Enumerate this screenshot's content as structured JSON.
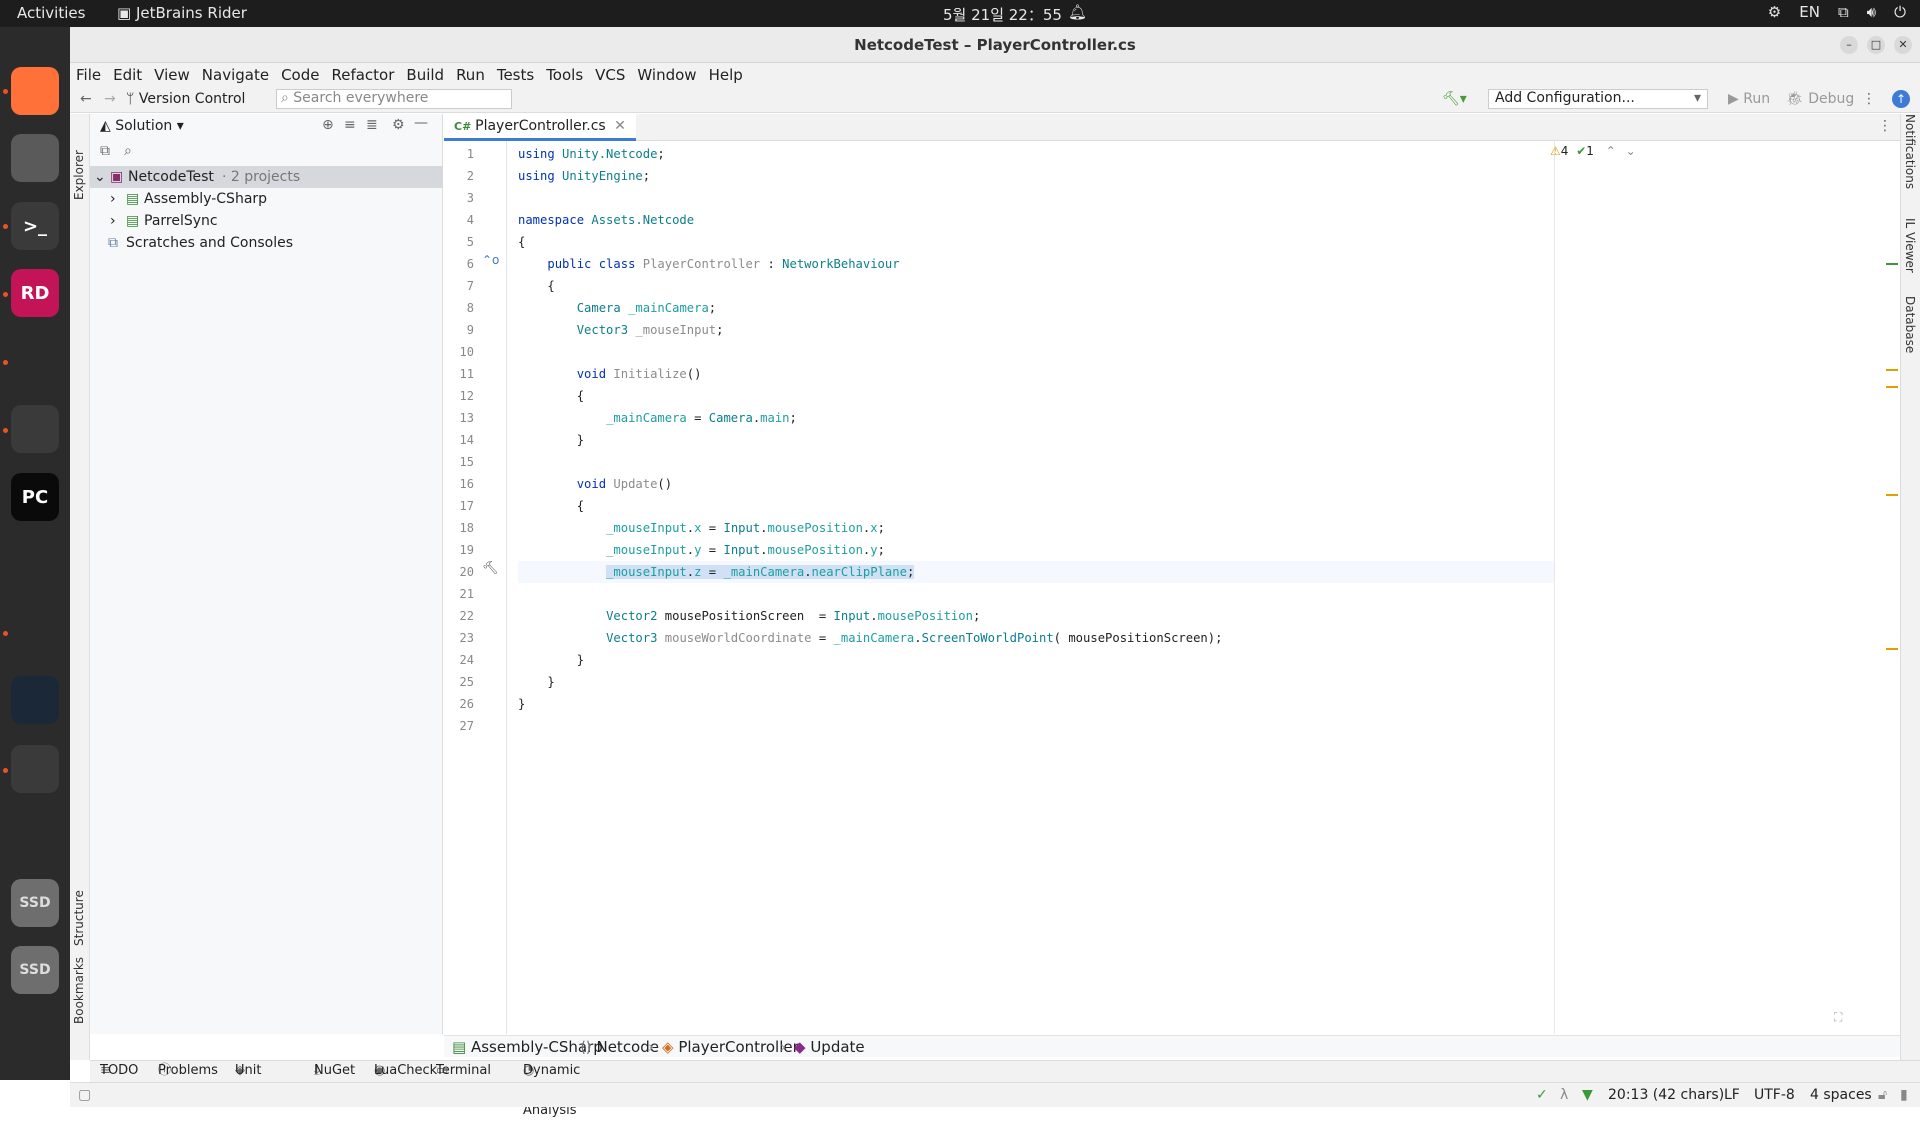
{
  "topbar": {
    "activities": "Activities",
    "app": "JetBrains Rider",
    "clock": "5월 21일  22：55",
    "lang": "EN"
  },
  "window": {
    "title": "NetcodeTest – PlayerController.cs"
  },
  "menu": [
    "File",
    "Edit",
    "View",
    "Navigate",
    "Code",
    "Refactor",
    "Build",
    "Run",
    "Tests",
    "Tools",
    "VCS",
    "Window",
    "Help"
  ],
  "toolbar": {
    "vcs": "Version Control",
    "search_placeholder": "Search everywhere",
    "config": "Add Configuration...",
    "run": "Run",
    "debug": "Debug"
  },
  "explorer": {
    "tab": "Explorer",
    "header": "Solution",
    "root": "NetcodeTest",
    "root_suffix": "· 2 projects",
    "items": [
      "Assembly-CSharp",
      "ParrelSync"
    ],
    "scratches": "Scratches and Consoles"
  },
  "editor": {
    "tab": "PlayerController.cs",
    "inspections": {
      "warnings": "4",
      "ok": "1"
    }
  },
  "code": [
    [
      [
        "kw",
        "using "
      ],
      [
        "ns",
        "Unity.Netcode"
      ],
      [
        "pl",
        ";"
      ]
    ],
    [
      [
        "kw",
        "using "
      ],
      [
        "ns",
        "UnityEngine"
      ],
      [
        "pl",
        ";"
      ]
    ],
    [],
    [
      [
        "kw",
        "namespace "
      ],
      [
        "ns",
        "Assets.Netcode"
      ]
    ],
    [
      [
        "pl",
        "{"
      ]
    ],
    [
      [
        "pl",
        "    "
      ],
      [
        "kw",
        "public class "
      ],
      [
        "mut",
        "PlayerController"
      ],
      [
        "pl",
        " : "
      ],
      [
        "cls",
        "NetworkBehaviour"
      ]
    ],
    [
      [
        "pl",
        "    {"
      ]
    ],
    [
      [
        "pl",
        "        "
      ],
      [
        "cls",
        "Camera "
      ],
      [
        "fld",
        "_mainCamera"
      ],
      [
        "pl",
        ";"
      ]
    ],
    [
      [
        "pl",
        "        "
      ],
      [
        "cls",
        "Vector3 "
      ],
      [
        "mut",
        "_mouseInput"
      ],
      [
        "pl",
        ";"
      ]
    ],
    [],
    [
      [
        "pl",
        "        "
      ],
      [
        "kw",
        "void "
      ],
      [
        "mut",
        "Initialize"
      ],
      [
        "pl",
        "()"
      ]
    ],
    [
      [
        "pl",
        "        {"
      ]
    ],
    [
      [
        "pl",
        "            "
      ],
      [
        "fld",
        "_mainCamera"
      ],
      [
        "pl",
        " = "
      ],
      [
        "cls",
        "Camera"
      ],
      [
        "pl",
        "."
      ],
      [
        "fld",
        "main"
      ],
      [
        "pl",
        ";"
      ]
    ],
    [
      [
        "pl",
        "        }"
      ]
    ],
    [],
    [
      [
        "pl",
        "        "
      ],
      [
        "kw",
        "void "
      ],
      [
        "mut",
        "Update"
      ],
      [
        "pl",
        "()"
      ]
    ],
    [
      [
        "pl",
        "        {"
      ]
    ],
    [
      [
        "pl",
        "            "
      ],
      [
        "fld",
        "_mouseInput"
      ],
      [
        "pl",
        "."
      ],
      [
        "fld",
        "x"
      ],
      [
        "pl",
        " = "
      ],
      [
        "cls",
        "Input"
      ],
      [
        "pl",
        "."
      ],
      [
        "fld",
        "mousePosition"
      ],
      [
        "pl",
        "."
      ],
      [
        "fld",
        "x"
      ],
      [
        "pl",
        ";"
      ]
    ],
    [
      [
        "pl",
        "            "
      ],
      [
        "fld",
        "_mouseInput"
      ],
      [
        "pl",
        "."
      ],
      [
        "fld",
        "y"
      ],
      [
        "pl",
        " = "
      ],
      [
        "cls",
        "Input"
      ],
      [
        "pl",
        "."
      ],
      [
        "fld",
        "mousePosition"
      ],
      [
        "pl",
        "."
      ],
      [
        "fld",
        "y"
      ],
      [
        "pl",
        ";"
      ]
    ],
    [
      [
        "pl",
        "            "
      ],
      [
        "fld",
        "_mouseInput"
      ],
      [
        "pl",
        "."
      ],
      [
        "fld",
        "z"
      ],
      [
        "pl",
        " = "
      ],
      [
        "fld",
        "_mainCamera"
      ],
      [
        "pl",
        "."
      ],
      [
        "fld",
        "nearClipPlane"
      ],
      [
        "pl",
        ";"
      ]
    ],
    [],
    [
      [
        "pl",
        "            "
      ],
      [
        "cls",
        "Vector2 "
      ],
      [
        "pl",
        "mousePositionScreen  = "
      ],
      [
        "cls",
        "Input"
      ],
      [
        "pl",
        "."
      ],
      [
        "fld",
        "mousePosition"
      ],
      [
        "pl",
        ";"
      ]
    ],
    [
      [
        "pl",
        "            "
      ],
      [
        "cls",
        "Vector3 "
      ],
      [
        "mut",
        "mouseWorldCoordinate"
      ],
      [
        "pl",
        " = "
      ],
      [
        "fld",
        "_mainCamera"
      ],
      [
        "pl",
        "."
      ],
      [
        "fn",
        "ScreenToWorldPoint"
      ],
      [
        "pl",
        "( mousePositionScreen);"
      ]
    ],
    [
      [
        "pl",
        "        }"
      ]
    ],
    [
      [
        "pl",
        "    }"
      ]
    ],
    [
      [
        "pl",
        "}"
      ]
    ],
    []
  ],
  "breadcrumb": [
    "Assembly-CSharp",
    "Netcode",
    "PlayerController",
    "Update"
  ],
  "toolwindows": [
    "TODO",
    "Problems",
    "Unit Tests",
    "NuGet",
    "LuaCheck",
    "Terminal",
    "Dynamic Program Analysis"
  ],
  "leftstrip": {
    "structure": "Structure",
    "bookmarks": "Bookmarks"
  },
  "rightstrip": [
    "Notifications",
    "IL Viewer",
    "Database"
  ],
  "status": {
    "position": "20:13 (42 chars)",
    "line_sep": "LF",
    "encoding": "UTF-8",
    "indent": "4 spaces"
  },
  "dock": [
    {
      "name": "firefox-icon",
      "label": "",
      "bg": "#ff7139"
    },
    {
      "name": "files-icon",
      "label": "",
      "bg": "#5a5a5a"
    },
    {
      "name": "terminal-icon",
      "label": ">_",
      "bg": "#3a3a3a"
    },
    {
      "name": "rider-icon",
      "label": "RD",
      "bg": "#c21456"
    },
    {
      "name": "chrome-icon",
      "label": "",
      "bg": "#2b2b2b"
    },
    {
      "name": "unity-hub-icon",
      "label": "",
      "bg": "#3a3a3a"
    },
    {
      "name": "pycharm-icon",
      "label": "PC",
      "bg": "#0a0a0a"
    },
    {
      "name": "blender-icon",
      "label": "",
      "bg": "#2b2b2b"
    },
    {
      "name": "vscode-icon",
      "label": "",
      "bg": "#2b2b2b"
    },
    {
      "name": "steam-icon",
      "label": "",
      "bg": "#1b2838"
    },
    {
      "name": "unity-icon",
      "label": "",
      "bg": "#3a3a3a"
    },
    {
      "name": "app-icon",
      "label": "",
      "bg": "#2b2b2b"
    },
    {
      "name": "ssd-icon",
      "label": "SSD",
      "bg": "#6e6e6e"
    },
    {
      "name": "ssd-icon-2",
      "label": "SSD",
      "bg": "#6e6e6e"
    },
    {
      "name": "show-apps-icon",
      "label": "",
      "bg": "#2b2b2b"
    }
  ]
}
